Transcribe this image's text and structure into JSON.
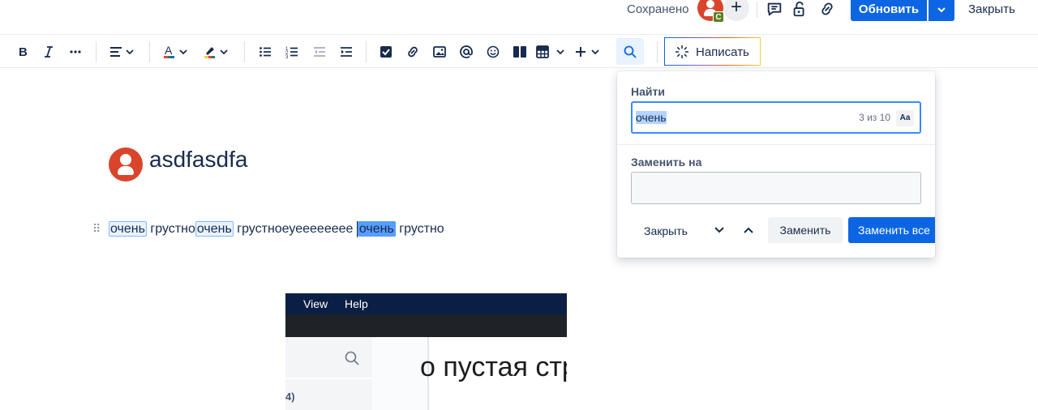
{
  "topbar": {
    "saved_status": "Сохранено",
    "avatar_badge": "C",
    "update_label": "Обновить",
    "close_label": "Закрыть"
  },
  "page": {
    "title": "asdfasdfa",
    "paragraph": [
      {
        "text": "очень",
        "match": true,
        "current": false
      },
      {
        "text": " грустно",
        "match": false,
        "current": false
      },
      {
        "text": "очень",
        "match": true,
        "current": false
      },
      {
        "text": " грустноеуееееееее ",
        "match": false,
        "current": false
      },
      {
        "text": "очень",
        "match": true,
        "current": true
      },
      {
        "text": " грустно",
        "match": false,
        "current": false
      }
    ]
  },
  "toolbar": {
    "write_label": "Написать"
  },
  "embedded_screenshot": {
    "menu_items": [
      "View",
      "Help"
    ],
    "heading": "о пустая стр",
    "side_text": "4)"
  },
  "find_replace": {
    "find_label": "Найти",
    "find_value": "очень",
    "match_count": "3 из 10",
    "case_toggle": "Aa",
    "replace_label": "Заменить на",
    "replace_value": "",
    "close_label": "Закрыть",
    "replace_label_btn": "Заменить",
    "replace_all_label": "Заменить все"
  },
  "colors": {
    "primary": "#0c66e4",
    "avatar": "#d9452b",
    "match_highlight": "#e9f2ff",
    "current_match": "#579dff"
  }
}
